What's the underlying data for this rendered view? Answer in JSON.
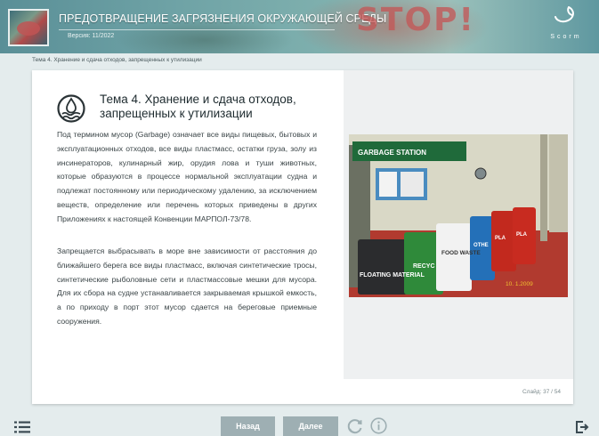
{
  "header": {
    "title": "ПРЕДОТВРАЩЕНИЕ ЗАГРЯЗНЕНИЯ ОКРУЖАЮЩЕЙ СРЕДЫ",
    "version": "Версия: 11/2022",
    "stop_text": "STOP!",
    "scorm_label": "Scorm"
  },
  "breadcrumb": "Тема 4. Хранение и сдача отходов, запрещенных к утилизации",
  "topic": {
    "icon": "water-pollution-icon",
    "title_line1": "Тема 4. Хранение и сдача отходов,",
    "title_line2": "запрещенных к утилизации"
  },
  "paragraphs": {
    "p1": "Под термином мусор (Garbage) означает все виды пищевых, бытовых и эксплуатационных отходов, все виды пластмасс, остатки груза, золу из инсинераторов, кулинарный жир, орудия лова и туши животных, которые образуются в процессе нормальной эксплуатации судна и подлежат постоянному или периодическому удалению, за исключением веществ, определение или перечень которых приведены в других Приложениях к настоящей Конвенции МАРПОЛ-73/78.",
    "p2": "Запрещается выбрасывать в море вне зависимости от расстояния до ближайшего берега все виды пластмасс, включая синтетические тросы, синтетические рыболовные сети и пластмассовые мешки для мусора. Для их сбора на судне устанавливается закрываемая крышкой емкость, а по приходу в порт этот мусор сдается на береговые приемные сооружения."
  },
  "photo": {
    "sign": "GARBAGE  STATION",
    "barrel_labels": [
      "FLOATING MATERIAL",
      "RECYC",
      "FOOD WASTE",
      "OTHE",
      "PLA",
      "PLA"
    ],
    "timestamp": "10. 1.2009"
  },
  "slide_counter": "Слайд: 37 / 54",
  "footer": {
    "back_label": "Назад",
    "next_label": "Далее"
  },
  "colors": {
    "accent": "#9eafb3",
    "header": "#6fa3a6",
    "text": "#3a4447"
  }
}
